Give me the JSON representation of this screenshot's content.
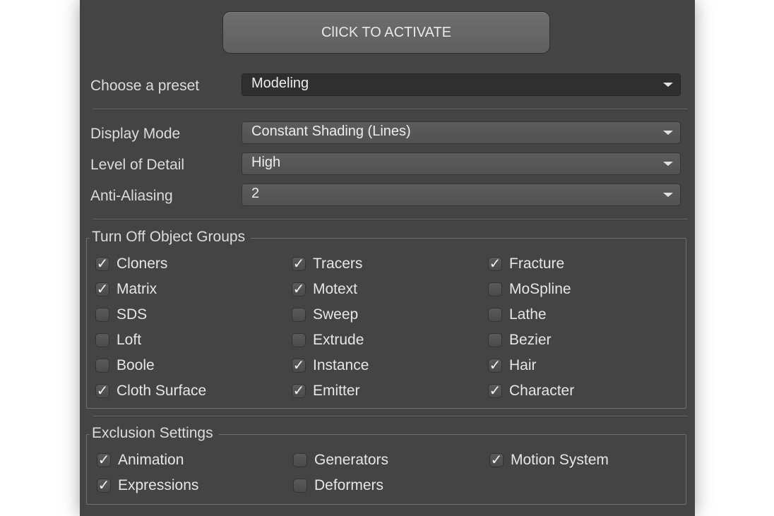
{
  "activate_button": {
    "label": "ClICK TO ACTIVATE"
  },
  "preset": {
    "label": "Choose a preset",
    "value": "Modeling"
  },
  "display_mode": {
    "label": "Display Mode",
    "value": "Constant Shading (Lines)"
  },
  "level_of_detail": {
    "label": "Level of Detail",
    "value": "High"
  },
  "anti_aliasing": {
    "label": "Anti-Aliasing",
    "value": "2"
  },
  "checkmark_glyph": "✓",
  "object_groups": {
    "title": "Turn Off Object Groups",
    "items": [
      {
        "label": "Cloners",
        "checked": true
      },
      {
        "label": "Tracers",
        "checked": true
      },
      {
        "label": "Fracture",
        "checked": true
      },
      {
        "label": "Matrix",
        "checked": true
      },
      {
        "label": "Motext",
        "checked": true
      },
      {
        "label": "MoSpline",
        "checked": false
      },
      {
        "label": "SDS",
        "checked": false
      },
      {
        "label": "Sweep",
        "checked": false
      },
      {
        "label": "Lathe",
        "checked": false
      },
      {
        "label": "Loft",
        "checked": false
      },
      {
        "label": "Extrude",
        "checked": false
      },
      {
        "label": "Bezier",
        "checked": false
      },
      {
        "label": "Boole",
        "checked": false
      },
      {
        "label": "Instance",
        "checked": true
      },
      {
        "label": "Hair",
        "checked": true
      },
      {
        "label": "Cloth Surface",
        "checked": true
      },
      {
        "label": "Emitter",
        "checked": true
      },
      {
        "label": "Character",
        "checked": true
      }
    ]
  },
  "exclusion_settings": {
    "title": "Exclusion Settings",
    "items": [
      {
        "label": "Animation",
        "checked": true
      },
      {
        "label": "Generators",
        "checked": false
      },
      {
        "label": "Motion System",
        "checked": true
      },
      {
        "label": "Expressions",
        "checked": true
      },
      {
        "label": "Deformers",
        "checked": false
      }
    ]
  }
}
